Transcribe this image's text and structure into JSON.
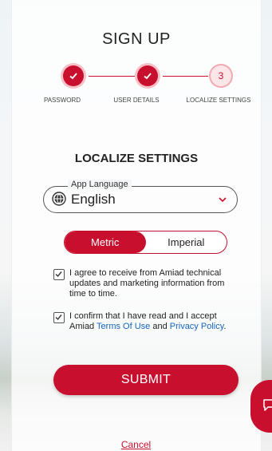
{
  "header": {
    "title": "SIGN UP"
  },
  "stepper": {
    "steps": [
      {
        "label": "PASSWORD",
        "state": "done"
      },
      {
        "label": "USER DETAILS",
        "state": "done"
      },
      {
        "label": "LOCALIZE SETTINGS",
        "state": "current",
        "number": "3"
      }
    ]
  },
  "section": {
    "heading": "LOCALIZE SETTINGS"
  },
  "language": {
    "legend": "App Language",
    "value": "English",
    "icon": "globe-icon"
  },
  "units": {
    "options": [
      "Metric",
      "Imperial"
    ],
    "selected": "Metric"
  },
  "consents": {
    "marketing": {
      "checked": true,
      "text": "I agree to receive from Amiad technical updates and marketing information from time to time."
    },
    "terms": {
      "checked": true,
      "prefix": "I confirm that I have read and I accept Amiad ",
      "terms_link": "Terms Of Use",
      "and": " and ",
      "privacy_link": "Privacy Policy",
      "suffix": "."
    }
  },
  "actions": {
    "submit": "SUBMIT",
    "cancel": "Cancel"
  },
  "colors": {
    "accent": "#c8102e",
    "link": "#1565c0"
  }
}
